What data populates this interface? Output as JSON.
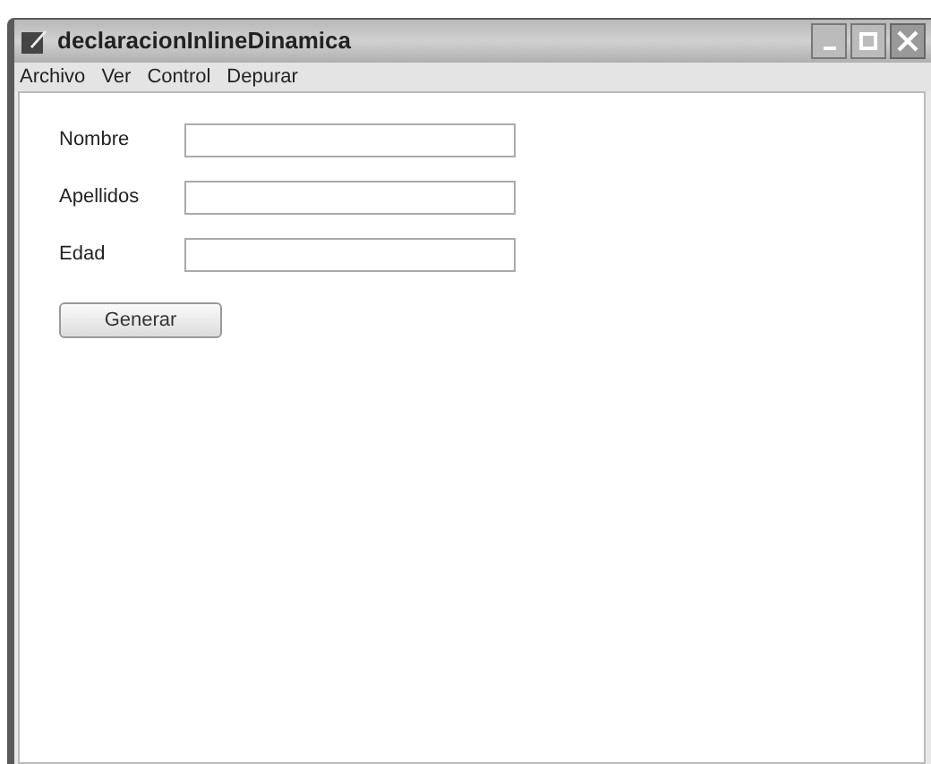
{
  "window": {
    "title": "declaracionInlineDinamica"
  },
  "menu": [
    "Archivo",
    "Ver",
    "Control",
    "Depurar"
  ],
  "fields": [
    {
      "label": "Nombre"
    },
    {
      "label": "Apellidos"
    },
    {
      "label": "Edad"
    }
  ],
  "button": "Generar"
}
